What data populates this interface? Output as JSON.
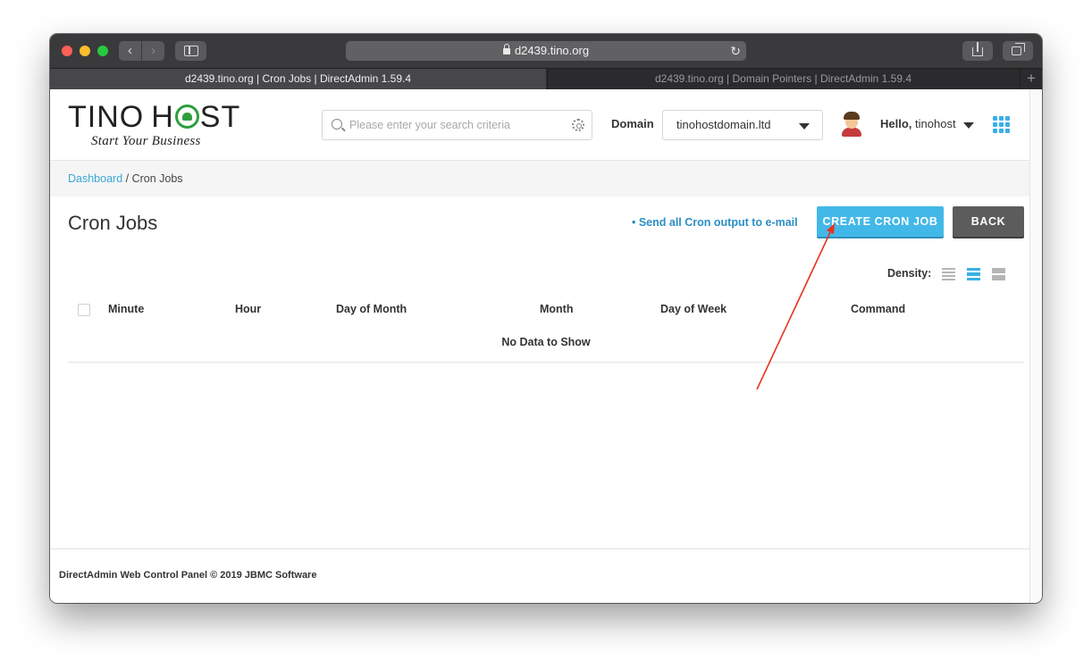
{
  "browser": {
    "url": "d2439.tino.org",
    "tabs": [
      {
        "label": "d2439.tino.org | Cron Jobs | DirectAdmin 1.59.4",
        "active": true
      },
      {
        "label": "d2439.tino.org | Domain Pointers | DirectAdmin 1.59.4",
        "active": false
      }
    ]
  },
  "header": {
    "logo": {
      "text_left": "TINO",
      "text_h": "H",
      "text_right": "ST",
      "tagline": "Start Your Business"
    },
    "search": {
      "placeholder": "Please enter your search criteria"
    },
    "domain_label": "Domain",
    "domain_value": "tinohostdomain.ltd",
    "hello": "Hello,",
    "username": "tinohost"
  },
  "breadcrumb": {
    "home": "Dashboard",
    "separator": " / ",
    "current": "Cron Jobs"
  },
  "page": {
    "title": "Cron Jobs",
    "email_link": "• Send all Cron output to e-mail",
    "create_button": "CREATE CRON JOB",
    "back_button": "BACK",
    "density_label": "Density:"
  },
  "table": {
    "columns": [
      "Minute",
      "Hour",
      "Day of Month",
      "Month",
      "Day of Week",
      "Command"
    ],
    "empty_text": "No Data to Show"
  },
  "footer": {
    "text": "DirectAdmin Web Control Panel © 2019 JBMC Software"
  },
  "colors": {
    "accent": "#42b8e8",
    "annotation_arrow": "#e8321e"
  }
}
